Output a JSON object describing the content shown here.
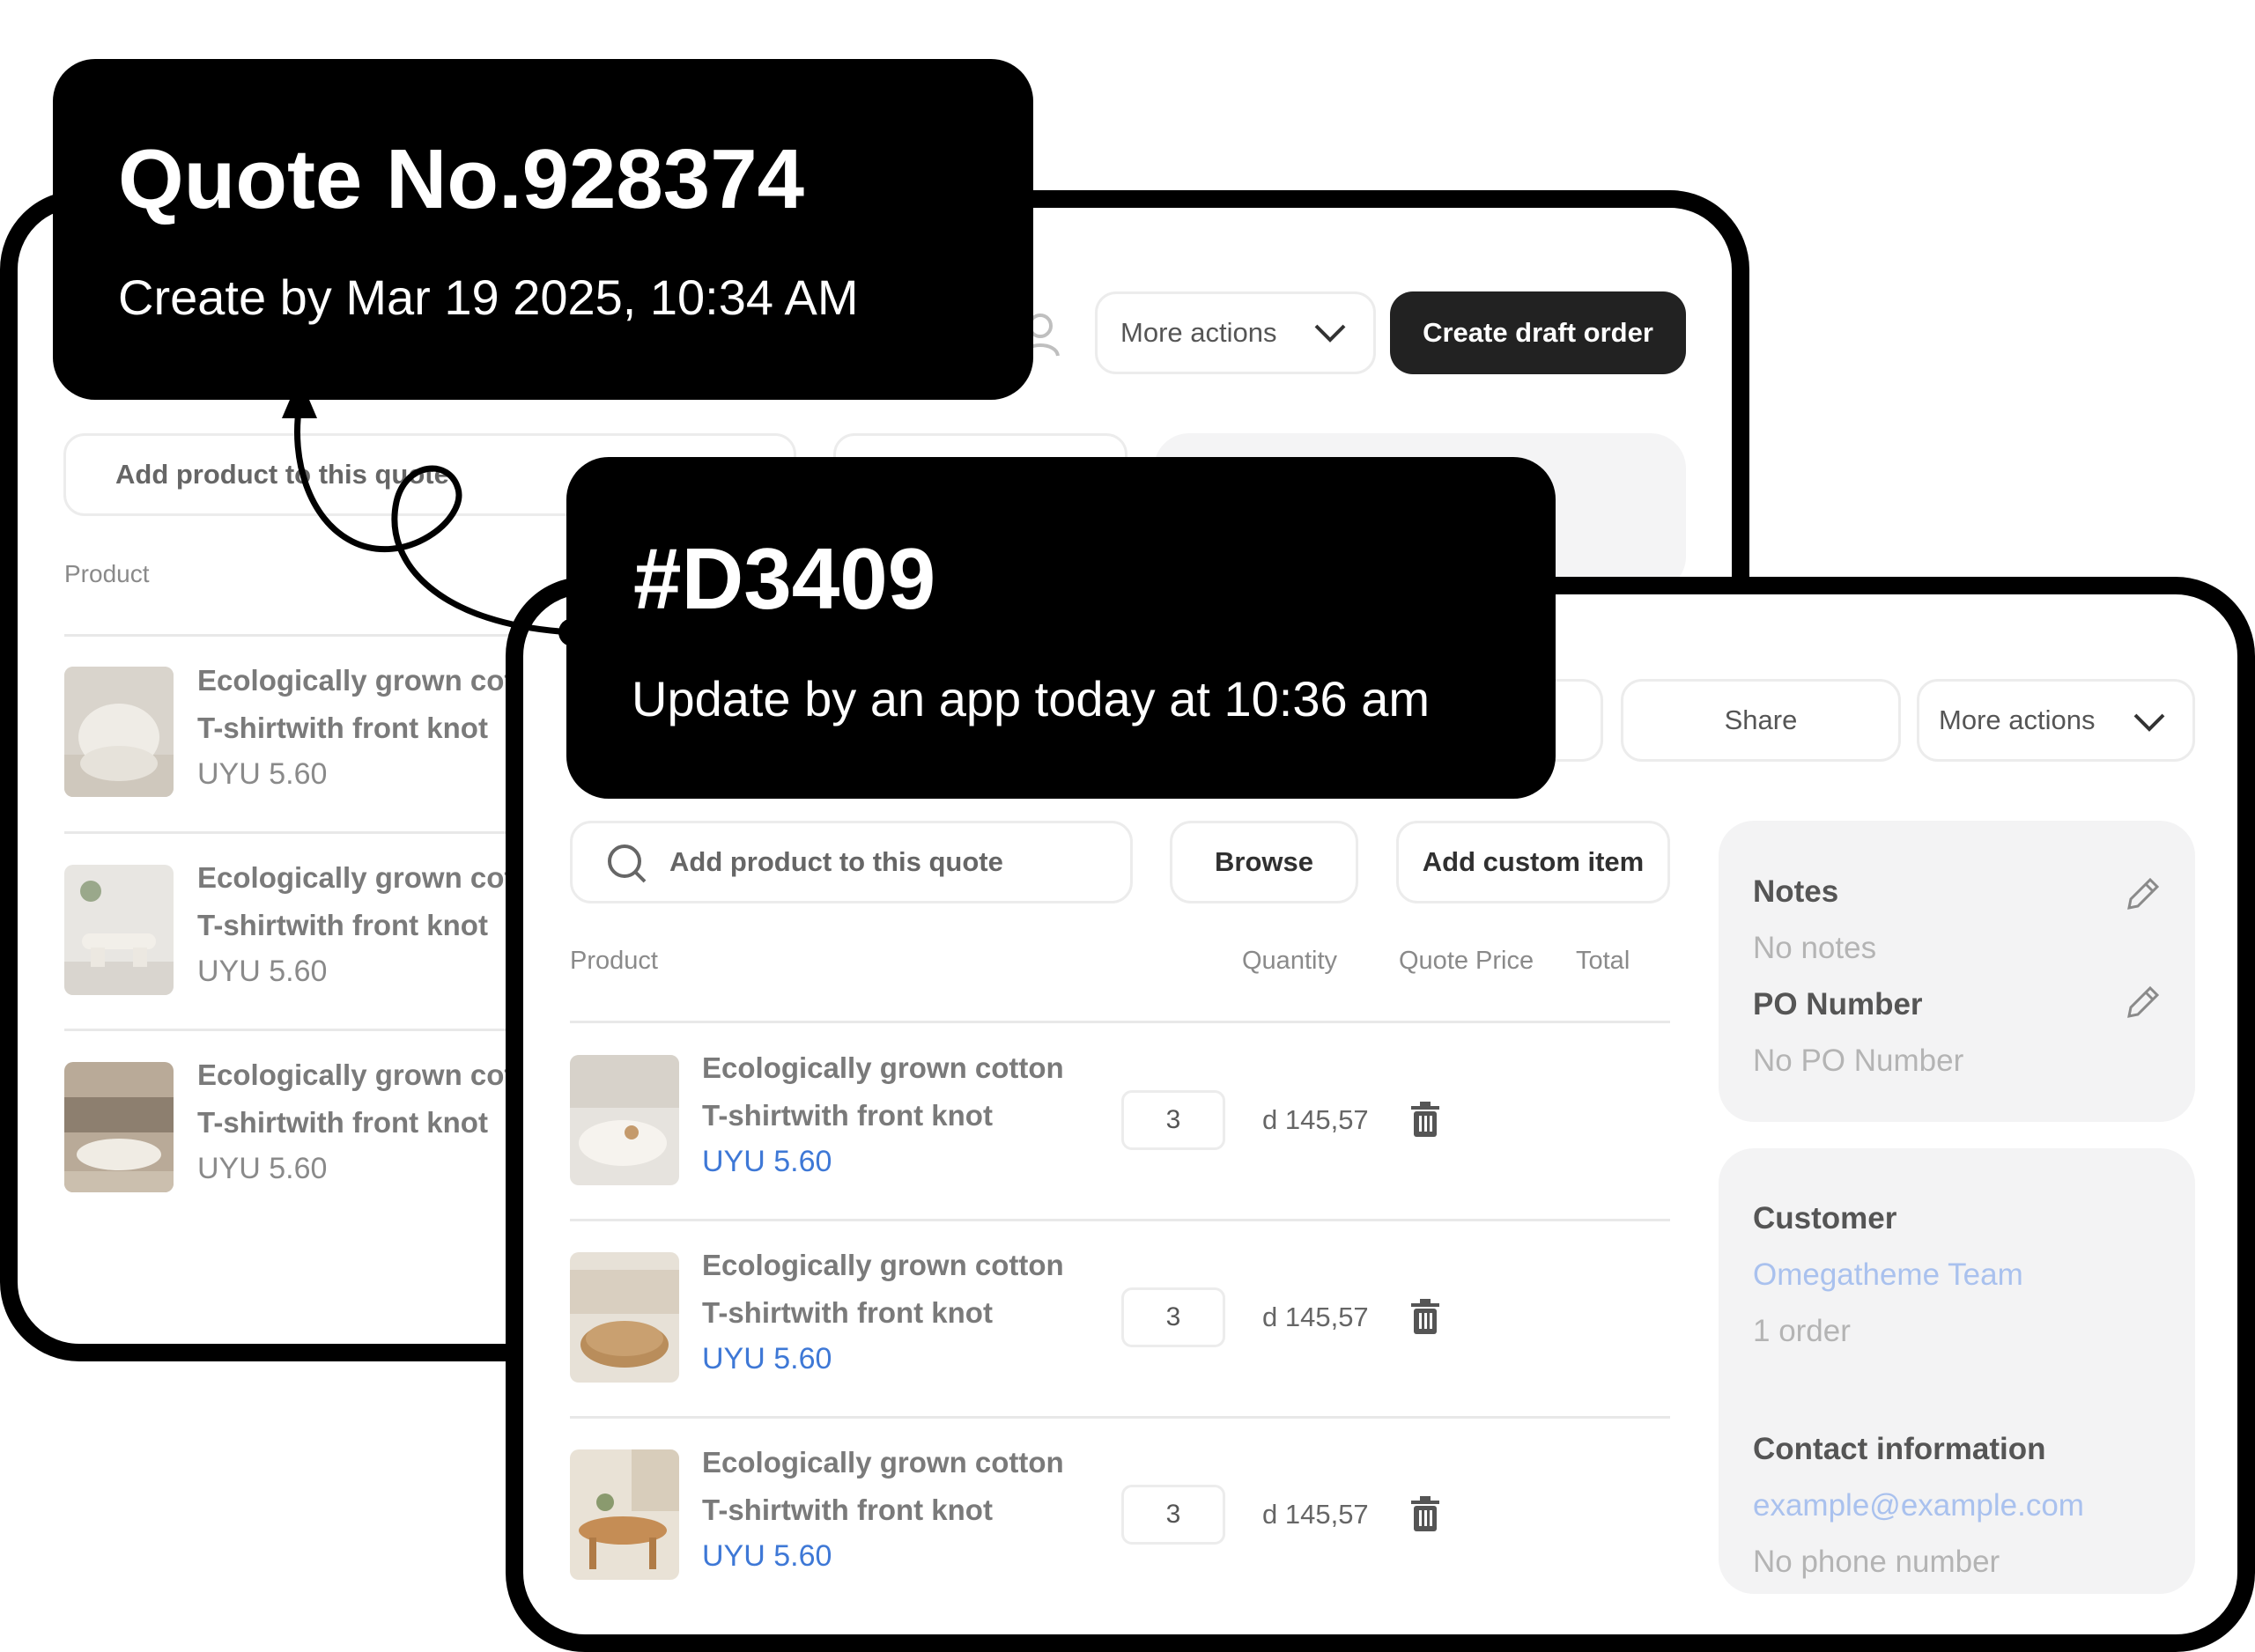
{
  "quote_callout": {
    "title": "Quote No.928374",
    "subtitle": "Create by Mar 19 2025, 10:34 AM"
  },
  "draft_callout": {
    "title": "#D3409",
    "subtitle": "Update by an app today at 10:36 am"
  },
  "back_card": {
    "more_actions_label": "More actions",
    "create_draft_label": "Create draft order",
    "search_placeholder": "Add product to this quote",
    "product_header": "Product",
    "items": [
      {
        "title_line1": "Ecologically grown cott",
        "title_line2": "T-shirtwith front knot",
        "price": "UYU 5.60"
      },
      {
        "title_line1": "Ecologically grown cott",
        "title_line2": "T-shirtwith front knot",
        "price": "UYU 5.60"
      },
      {
        "title_line1": "Ecologically grown cott",
        "title_line2": "T-shirtwith front knot",
        "price": "UYU 5.60"
      }
    ]
  },
  "front_card": {
    "share_label": "Share",
    "more_actions_label": "More actions",
    "search_placeholder": "Add product to this quote",
    "browse_label": "Browse",
    "add_custom_label": "Add custom item",
    "columns": {
      "product": "Product",
      "quantity": "Quantity",
      "quote_price": "Quote Price",
      "total": "Total"
    },
    "items": [
      {
        "title_line1": "Ecologically grown cotton",
        "title_line2": "T-shirtwith front knot",
        "price": "UYU 5.60",
        "quantity": "3",
        "quote_price": "d 145,57"
      },
      {
        "title_line1": "Ecologically grown cotton",
        "title_line2": "T-shirtwith front knot",
        "price": "UYU 5.60",
        "quantity": "3",
        "quote_price": "d 145,57"
      },
      {
        "title_line1": "Ecologically grown cotton",
        "title_line2": "T-shirtwith front knot",
        "price": "UYU 5.60",
        "quantity": "3",
        "quote_price": "d 145,57"
      }
    ],
    "notes": {
      "label": "Notes",
      "value": "No notes"
    },
    "po": {
      "label": "PO Number",
      "value": "No PO Number"
    },
    "customer": {
      "label": "Customer",
      "name": "Omegatheme Team",
      "orders": "1 order"
    },
    "contact": {
      "label": "Contact information",
      "email": "example@example.com",
      "phone": "No phone number"
    }
  },
  "colors": {
    "price_link": "#3e78d6",
    "callout_bg": "#000000",
    "primary_button": "#222222"
  }
}
